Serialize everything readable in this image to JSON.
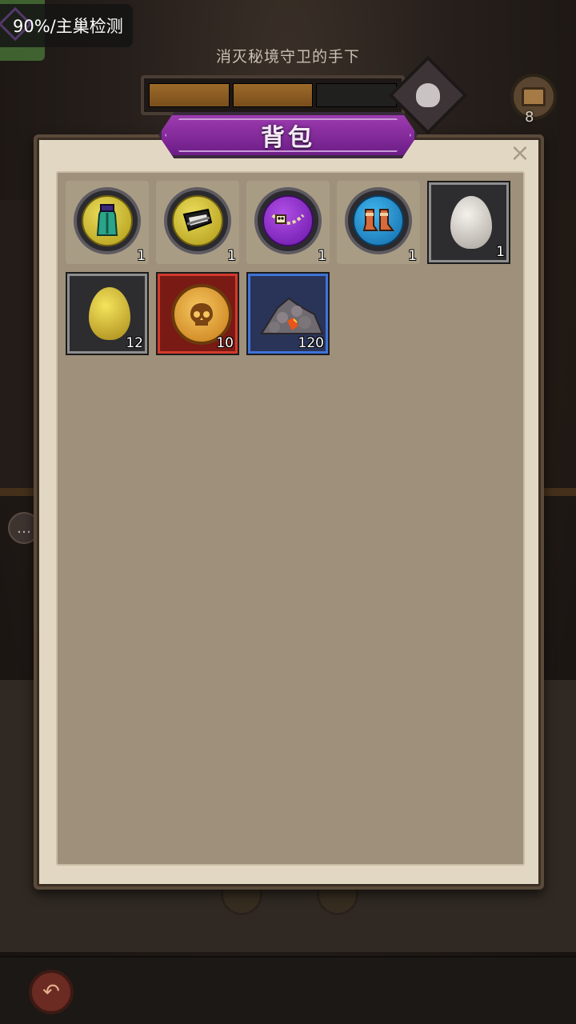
{
  "status_overlay": {
    "text": "90%/主巢检测"
  },
  "quest": {
    "text": "消灭秘境守卫的手下",
    "progress": 0.67,
    "chest_count": "8"
  },
  "panel": {
    "title": "背包",
    "close_label": "×"
  },
  "items": [
    {
      "name": "teal-robe",
      "frame": "gold-ring",
      "count": "1"
    },
    {
      "name": "black-hat",
      "frame": "gold-ring",
      "count": "1"
    },
    {
      "name": "bone-necklace",
      "frame": "purple-ring",
      "count": "1"
    },
    {
      "name": "copper-boots",
      "frame": "blue-ring",
      "count": "1"
    },
    {
      "name": "white-egg",
      "frame": "grey-box",
      "count": "1"
    },
    {
      "name": "yellow-egg",
      "frame": "grey-box",
      "count": "12"
    },
    {
      "name": "skull-coin",
      "frame": "red-box",
      "count": "10"
    },
    {
      "name": "lava-ore-pile",
      "frame": "blue-box",
      "count": "120"
    }
  ],
  "colors": {
    "panel_bg": "#9e907b",
    "panel_border": "#e2d7c3",
    "title_banner": "#8a2ea0",
    "rarity_gold": "#d4c23a",
    "rarity_purple": "#9a35d4",
    "rarity_blue": "#2f96d8",
    "rarity_red": "#d23b2c",
    "rarity_blue_box": "#3f74d8"
  }
}
